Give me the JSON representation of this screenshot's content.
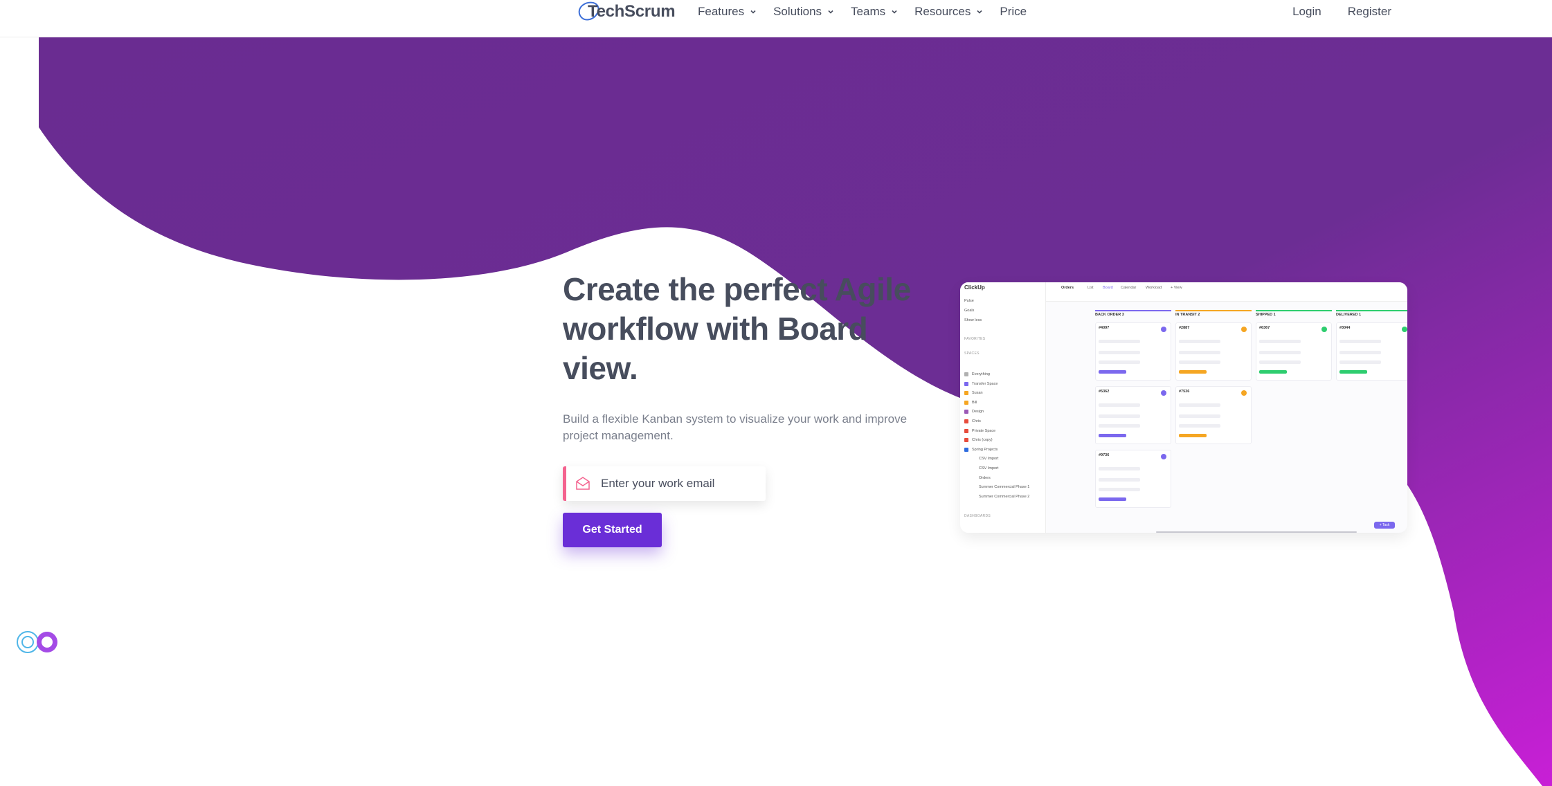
{
  "header": {
    "logo_text": "TechScrum",
    "nav": [
      {
        "label": "Features",
        "has_dropdown": true
      },
      {
        "label": "Solutions",
        "has_dropdown": true
      },
      {
        "label": "Teams",
        "has_dropdown": true
      },
      {
        "label": "Resources",
        "has_dropdown": true
      },
      {
        "label": "Price",
        "has_dropdown": false
      }
    ],
    "login": "Login",
    "register": "Register"
  },
  "hero": {
    "title": "Create the perfect Agile workflow with Board view.",
    "subtitle": "Build a flexible Kanban system to visualize your work and improve project management.",
    "email_placeholder": "Enter your work email",
    "cta": "Get Started"
  },
  "mockup": {
    "brand": "ClickUp",
    "sidebar": [
      "Pulse",
      "Goals",
      "Show less"
    ],
    "favorites_label": "FAVORITES",
    "spaces_label": "SPACES",
    "spaces": [
      {
        "name": "Everything",
        "color": "#b0b0b0"
      },
      {
        "name": "Transfer Space",
        "color": "#7b68ee"
      },
      {
        "name": "Susan",
        "color": "#f5a623"
      },
      {
        "name": "Bill",
        "color": "#f5a623"
      },
      {
        "name": "Design",
        "color": "#9b59b6"
      },
      {
        "name": "Chris",
        "color": "#e74c3c"
      },
      {
        "name": "Private Space",
        "color": "#e74c3c"
      },
      {
        "name": "Chris (copy)",
        "color": "#e74c3c"
      },
      {
        "name": "Spring Projects",
        "color": "#2d6cdf"
      },
      {
        "name": "CSV Import",
        "color": ""
      },
      {
        "name": "CSV Import",
        "color": ""
      },
      {
        "name": "Orders",
        "color": ""
      },
      {
        "name": "Summer Commercial Phase 1",
        "color": ""
      },
      {
        "name": "Summer Commercial Phase 2",
        "color": ""
      }
    ],
    "dashboards_label": "DASHBOARDS",
    "view_title": "Orders",
    "tabs": [
      "List",
      "Board",
      "Calendar",
      "Workload",
      "+ View"
    ],
    "columns": [
      {
        "name": "BACK ORDER",
        "count": "3",
        "color": "#7b68ee"
      },
      {
        "name": "IN TRANSIT",
        "count": "2",
        "color": "#f5a623"
      },
      {
        "name": "SHIPPED",
        "count": "1",
        "color": "#2ecd6f"
      },
      {
        "name": "DELIVERED",
        "count": "1",
        "color": "#2ecd6f"
      }
    ],
    "cards": [
      {
        "col": 0,
        "id": "#4097"
      },
      {
        "col": 0,
        "id": "#5362"
      },
      {
        "col": 0,
        "id": "#9736"
      },
      {
        "col": 1,
        "id": "#2887"
      },
      {
        "col": 1,
        "id": "#7536"
      },
      {
        "col": 2,
        "id": "#6367"
      },
      {
        "col": 3,
        "id": "#3044"
      }
    ],
    "task_button": "+ Task"
  },
  "colors": {
    "brand_purple": "#6a2c91",
    "accent_magenta": "#c81fd6",
    "cta": "#6a2ed7",
    "email_accent": "#f4638f"
  }
}
